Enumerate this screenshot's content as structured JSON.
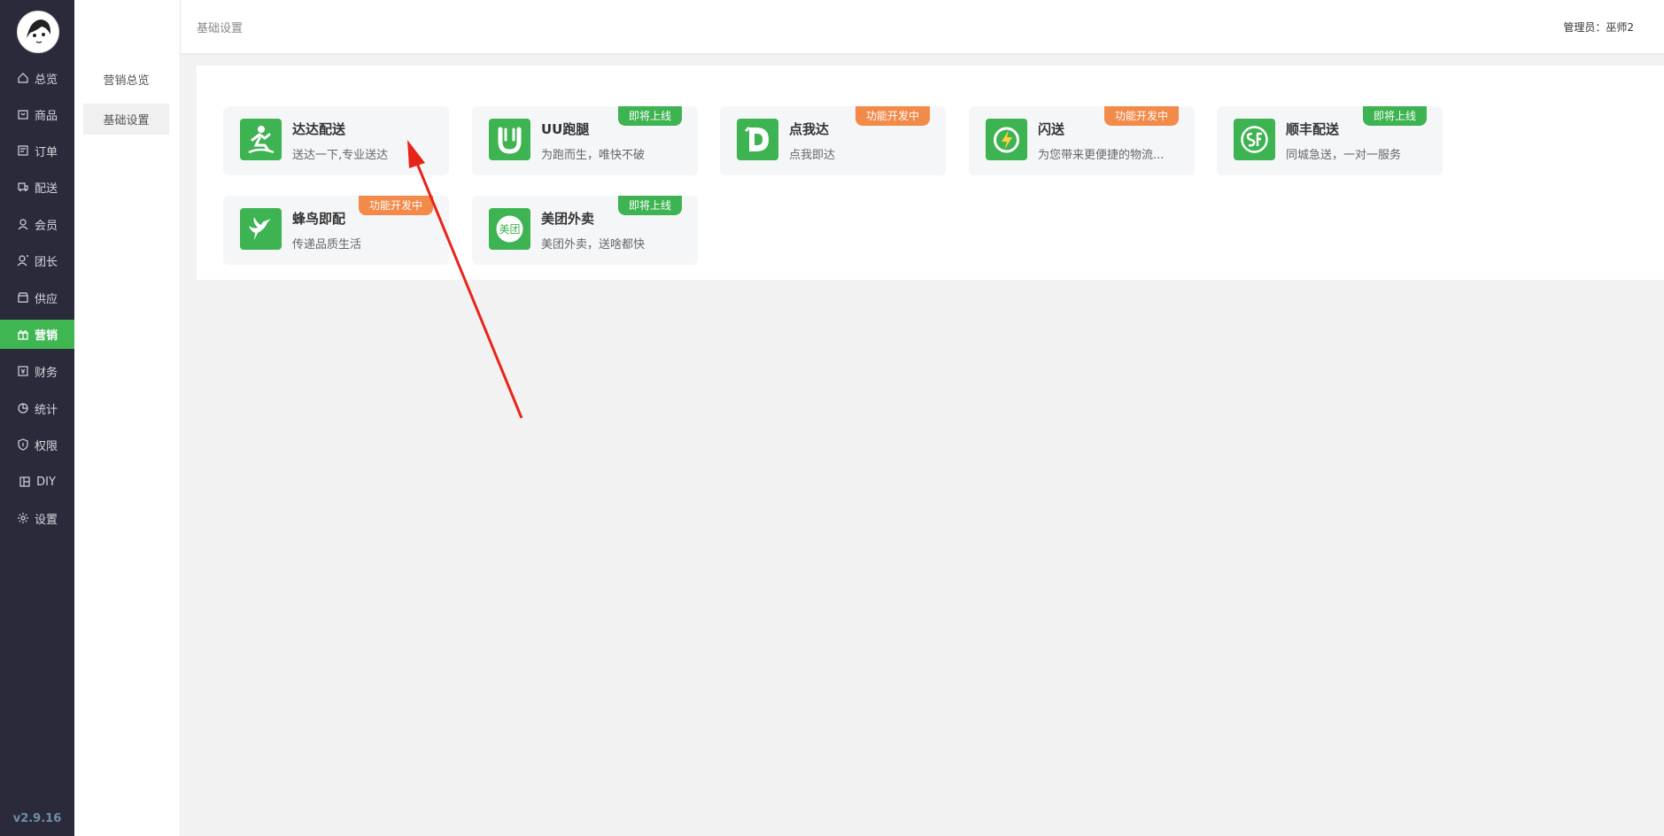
{
  "sidebar": {
    "items": [
      {
        "label": "总览",
        "icon": "home-icon",
        "active": false
      },
      {
        "label": "商品",
        "icon": "goods-icon",
        "active": false
      },
      {
        "label": "订单",
        "icon": "order-icon",
        "active": false
      },
      {
        "label": "配送",
        "icon": "delivery-icon",
        "active": false
      },
      {
        "label": "会员",
        "icon": "member-icon",
        "active": false
      },
      {
        "label": "团长",
        "icon": "leader-icon",
        "active": false
      },
      {
        "label": "供应",
        "icon": "supply-icon",
        "active": false
      },
      {
        "label": "营销",
        "icon": "gift-icon",
        "active": true
      },
      {
        "label": "财务",
        "icon": "finance-icon",
        "active": false
      },
      {
        "label": "统计",
        "icon": "pie-chart-icon",
        "active": false
      },
      {
        "label": "权限",
        "icon": "shield-icon",
        "active": false
      },
      {
        "label": "DIY",
        "icon": "layout-icon",
        "active": false
      },
      {
        "label": "设置",
        "icon": "gear-icon",
        "active": false
      }
    ],
    "version": "v2.9.16",
    "accent": "#3fb652"
  },
  "subnav": {
    "items": [
      {
        "label": "营销总览",
        "active": false
      },
      {
        "label": "基础设置",
        "active": true
      }
    ]
  },
  "header": {
    "breadcrumb": "基础设置",
    "admin_label": "管理员：",
    "admin_name": "巫师2"
  },
  "cards": [
    {
      "title": "达达配送",
      "desc": "送达一下,专业送达",
      "badge": "",
      "icon": "dada-logo-icon"
    },
    {
      "title": "UU跑腿",
      "desc": "为跑而生，唯快不破",
      "badge": "即将上线",
      "badge_color": "green",
      "icon": "uu-logo-icon"
    },
    {
      "title": "点我达",
      "desc": "点我即达",
      "badge": "功能开发中",
      "badge_color": "orange",
      "icon": "dianwoda-logo-icon"
    },
    {
      "title": "闪送",
      "desc": "为您带来更便捷的物流...",
      "badge": "功能开发中",
      "badge_color": "orange",
      "icon": "shansong-logo-icon"
    },
    {
      "title": "顺丰配送",
      "desc": "同城急送，一对一服务",
      "badge": "即将上线",
      "badge_color": "green",
      "icon": "sf-logo-icon"
    },
    {
      "title": "蜂鸟即配",
      "desc": "传递品质生活",
      "badge": "功能开发中",
      "badge_color": "orange",
      "icon": "fengniao-logo-icon"
    },
    {
      "title": "美团外卖",
      "desc": "美团外卖，送啥都快",
      "badge": "即将上线",
      "badge_color": "green",
      "icon": "meituan-logo-icon"
    }
  ],
  "meituan_icon_text": "美团",
  "colors": {
    "green": "#3db351",
    "orange": "#f28a49",
    "annotation": "#e8241a"
  }
}
